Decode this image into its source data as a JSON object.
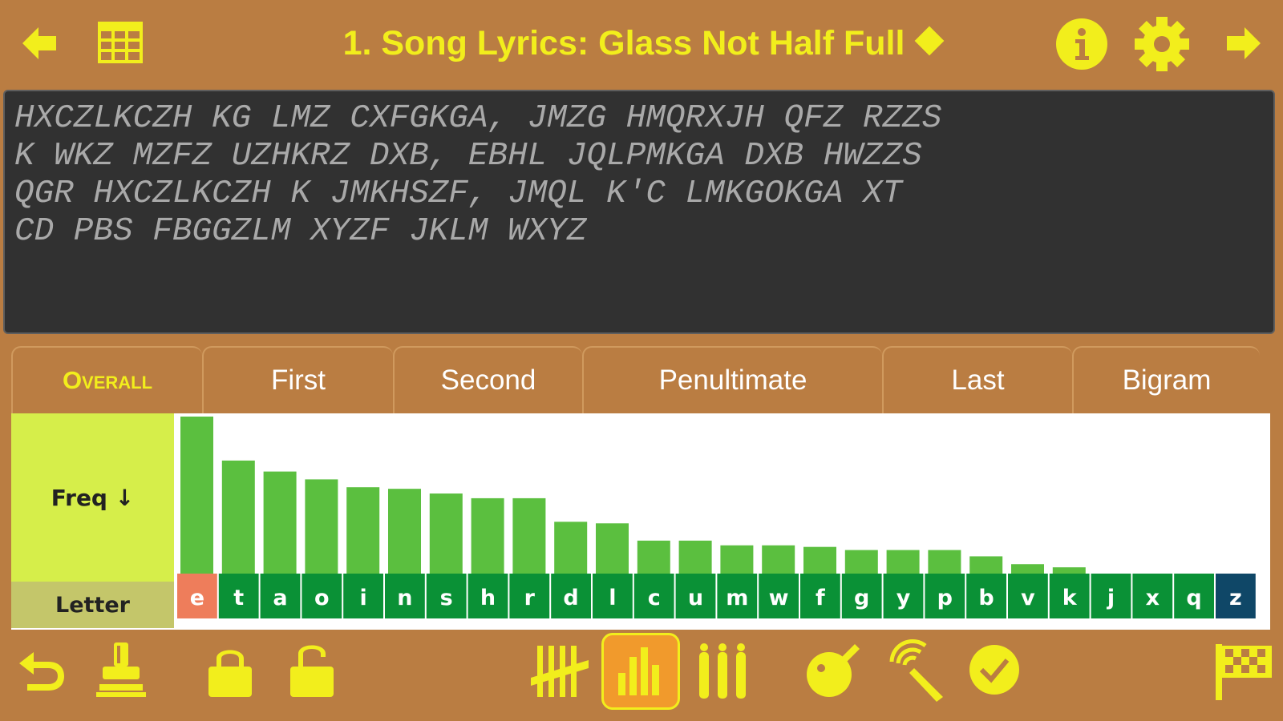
{
  "header": {
    "title": "1. Song Lyrics: Glass Not Half Full",
    "back_icon": "back-arrow-icon",
    "grid_icon": "grid-icon",
    "info_icon": "info-icon",
    "settings_icon": "gear-icon",
    "forward_icon": "forward-arrow-icon"
  },
  "cipher": {
    "lines": [
      "HXCZLKCZH KG LMZ CXFGKGA, JMZG HMQRXJH QFZ RZZS",
      "K WKZ MZFZ UZHKRZ DXB, EBHL JQLPMKGA DXB HWZZS",
      "QGR HXCZLKCZH K JMKHSZF, JMQL K'C LMKGOKGA XT",
      "CD PBS FBGGZLM XYZF JKLM WXYZ"
    ]
  },
  "tabs": [
    {
      "label": "Overall",
      "active": true
    },
    {
      "label": "First",
      "active": false
    },
    {
      "label": "Second",
      "active": false
    },
    {
      "label": "Penultimate",
      "active": false
    },
    {
      "label": "Last",
      "active": false
    },
    {
      "label": "Bigram",
      "active": false
    }
  ],
  "frequency": {
    "freq_label": "Freq ↓",
    "letter_label": "Letter"
  },
  "chart_data": {
    "type": "bar",
    "categories": [
      "e",
      "t",
      "a",
      "o",
      "i",
      "n",
      "s",
      "h",
      "r",
      "d",
      "l",
      "c",
      "u",
      "m",
      "w",
      "f",
      "g",
      "y",
      "p",
      "b",
      "v",
      "k",
      "j",
      "x",
      "q",
      "z"
    ],
    "values": [
      100,
      72,
      65,
      60,
      55,
      54,
      51,
      48,
      48,
      33,
      32,
      21,
      21,
      18,
      18,
      17,
      15,
      15,
      15,
      11,
      6,
      4,
      0,
      0,
      0,
      0
    ],
    "ylim": [
      0,
      100
    ],
    "colors": {
      "bar": "#5bbf3f",
      "cell": "#0a9136",
      "cell_first": "#ee7d5b",
      "cell_last": "#0f4767"
    }
  },
  "toolbar": {
    "icons": [
      "undo-icon",
      "stamp-icon",
      "lock-icon",
      "unlock-icon",
      "tally-icon",
      "bar-chart-icon",
      "columns-icon",
      "bomb-icon",
      "magnify-icon",
      "check-icon",
      "finish-flag-icon"
    ],
    "active": "bar-chart-icon"
  },
  "colors": {
    "accent": "#f2ee1c",
    "background": "#ba7d42",
    "panel": "#313131"
  }
}
